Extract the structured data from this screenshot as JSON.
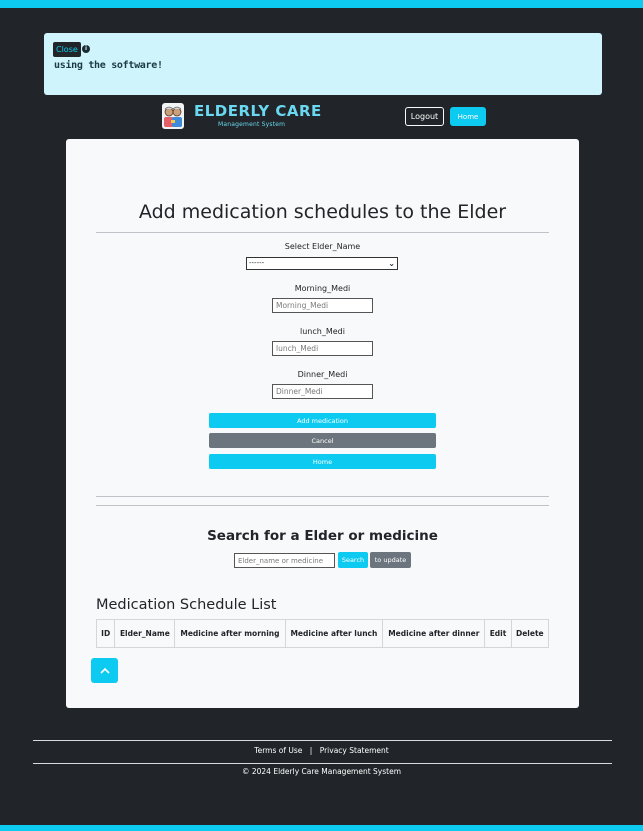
{
  "alert": {
    "close_label": "Close",
    "info_icon": "info-icon",
    "message": "using the software!"
  },
  "header": {
    "brand_title": "ELDERLY CARE",
    "brand_subtitle": "Management System",
    "logo_icon": "elderly-couple-icon",
    "logout_label": "Logout",
    "home_label": "Home"
  },
  "form": {
    "title": "Add medication schedules to the Elder",
    "elder_label": "Select Elder_Name",
    "elder_selected": "------",
    "morning_label": "Morning_Medi",
    "morning_placeholder": "Morning_Medi",
    "lunch_label": "lunch_Medi",
    "lunch_placeholder": "lunch_Medi",
    "dinner_label": "Dinner_Medi",
    "dinner_placeholder": "Dinner_Medi",
    "add_label": "Add medication",
    "cancel_label": "Cancel",
    "home_label": "Home"
  },
  "search": {
    "title": "Search for a Elder or medicine",
    "placeholder": "Elder_name or medicine",
    "search_label": "Search",
    "update_label": "to update"
  },
  "schedule_list": {
    "title": "Medication Schedule List",
    "columns": [
      "ID",
      "Elder_Name",
      "Medicine after morning",
      "Medicine after lunch",
      "Medicine after dinner",
      "Edit",
      "Delete"
    ]
  },
  "scroll_top_icon": "chevron-up-icon",
  "footer": {
    "terms_label": "Terms of Use",
    "separator": "|",
    "privacy_label": "Privacy Statement",
    "copyright": "© 2024 Elderly Care Management System"
  },
  "colors": {
    "accent": "#0dcaf0",
    "background": "#212529",
    "secondary": "#6c757d",
    "alert_bg": "#cff4fc"
  }
}
